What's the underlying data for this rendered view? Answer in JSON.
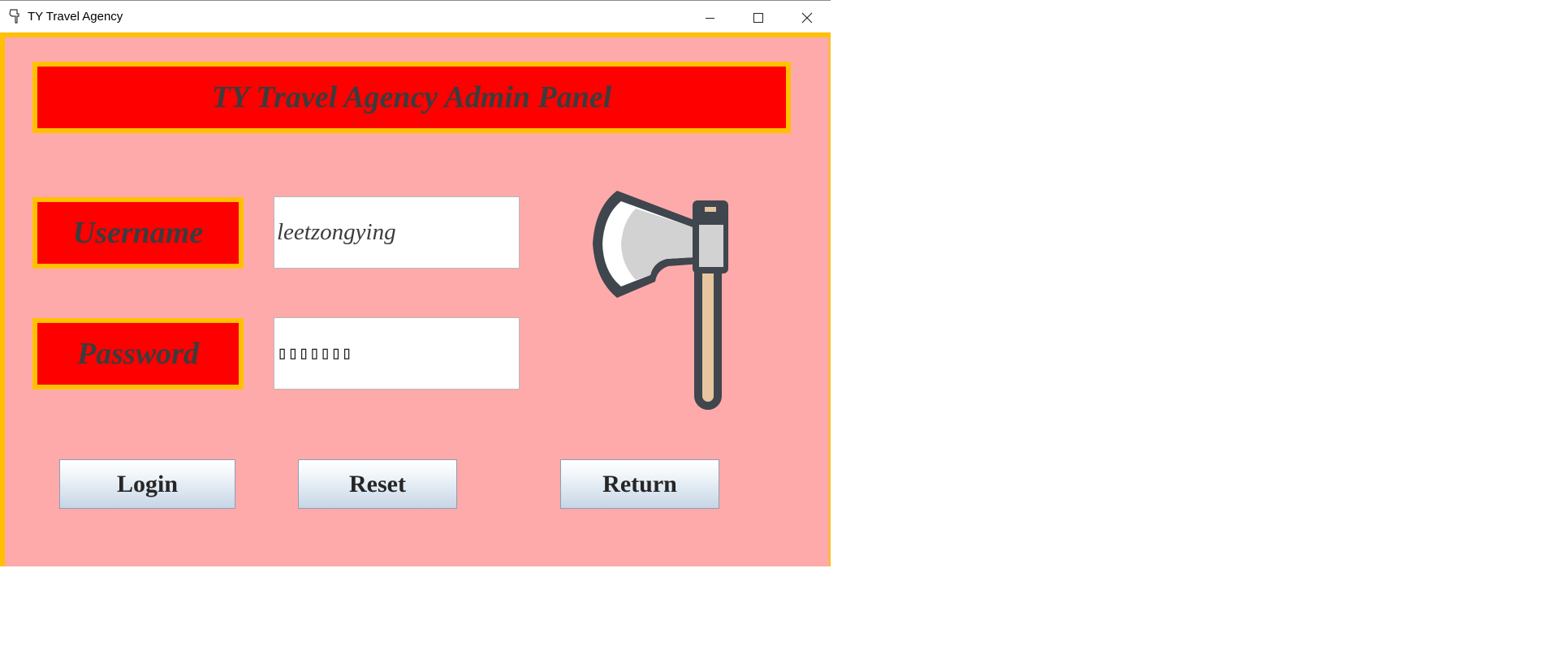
{
  "window": {
    "title": "TY Travel Agency",
    "controls": {
      "minimize_icon": "minimize-icon",
      "maximize_icon": "maximize-icon",
      "close_icon": "close-icon"
    }
  },
  "panel": {
    "header": "TY Travel Agency Admin Panel",
    "username_label": "Username",
    "username_value": "leetzongying",
    "password_label": "Password",
    "password_value": "▯▯▯▯▯▯▯",
    "logo_icon": "axe-icon"
  },
  "buttons": {
    "login": "Login",
    "reset": "Reset",
    "return": "Return"
  },
  "colors": {
    "panel_background": "#feaaaa",
    "label_background": "#ff0000",
    "border": "#ffc000",
    "label_text": "#3c3c3c"
  }
}
